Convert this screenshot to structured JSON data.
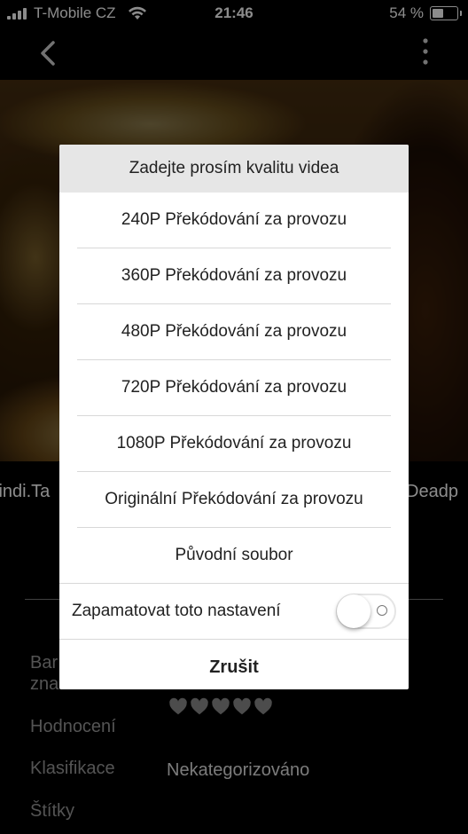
{
  "status_bar": {
    "carrier": "T-Mobile CZ",
    "time": "21:46",
    "battery_percent": "54 %",
    "battery_level": 0.54
  },
  "background": {
    "title_left": "lindi.Ta",
    "title_right": "Deadp",
    "meta": {
      "band_label": "Bar zna",
      "rating_label": "Hodnocení",
      "rating_value": 0,
      "rating_max": 5,
      "classification_label": "Klasifikace",
      "classification_value": "Nekategorizováno",
      "tags_label": "Štítky"
    }
  },
  "dialog": {
    "title": "Zadejte prosím kvalitu videa",
    "options": [
      "240P Překódování za provozu",
      "360P Překódování za provozu",
      "480P Překódování za provozu",
      "720P Překódování za provozu",
      "1080P Překódování za provozu",
      "Originální Překódování za provozu",
      "Původní soubor"
    ],
    "remember_label": "Zapamatovat toto nastavení",
    "remember_enabled": false,
    "cancel_label": "Zrušit"
  }
}
